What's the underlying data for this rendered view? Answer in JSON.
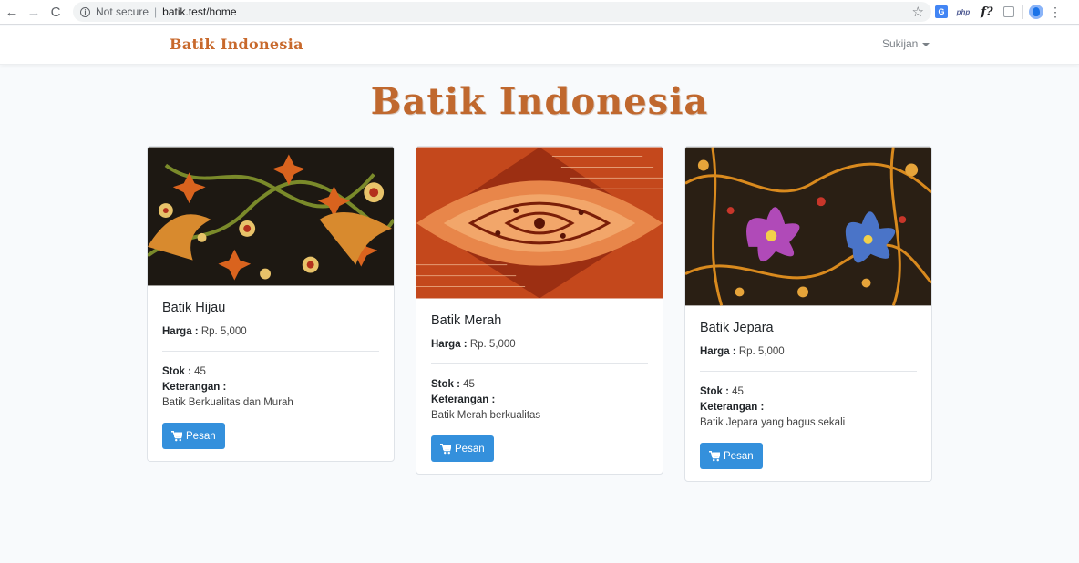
{
  "browser": {
    "back_icon": "←",
    "forward_icon": "→",
    "reload_icon": "C",
    "secure_label": "Not secure",
    "separator": "|",
    "url": "batik.test/home",
    "star_icon": "☆",
    "ext_translate": "G",
    "ext_php": "php",
    "ext_f": "f?",
    "menu_icon": "⋮"
  },
  "navbar": {
    "brand": "Batik Indonesia",
    "user": "Sukijan"
  },
  "main": {
    "title": "Batik Indonesia",
    "products": [
      {
        "name": "Batik Hijau",
        "price_label": "Harga :",
        "price": "Rp. 5,000",
        "stock_label": "Stok :",
        "stock": "45",
        "desc_label": "Keterangan :",
        "desc": "Batik Berkualitas dan Murah",
        "button": "Pesan"
      },
      {
        "name": "Batik Merah",
        "price_label": "Harga :",
        "price": "Rp. 5,000",
        "stock_label": "Stok :",
        "stock": "45",
        "desc_label": "Keterangan :",
        "desc": "Batik Merah berkualitas",
        "button": "Pesan"
      },
      {
        "name": "Batik Jepara",
        "price_label": "Harga :",
        "price": "Rp. 5,000",
        "stock_label": "Stok :",
        "stock": "45",
        "desc_label": "Keterangan :",
        "desc": "Batik Jepara yang bagus sekali",
        "button": "Pesan"
      }
    ]
  },
  "colors": {
    "accent": "#3490dc",
    "brand": "#c8692c",
    "background": "#f8fafc"
  }
}
